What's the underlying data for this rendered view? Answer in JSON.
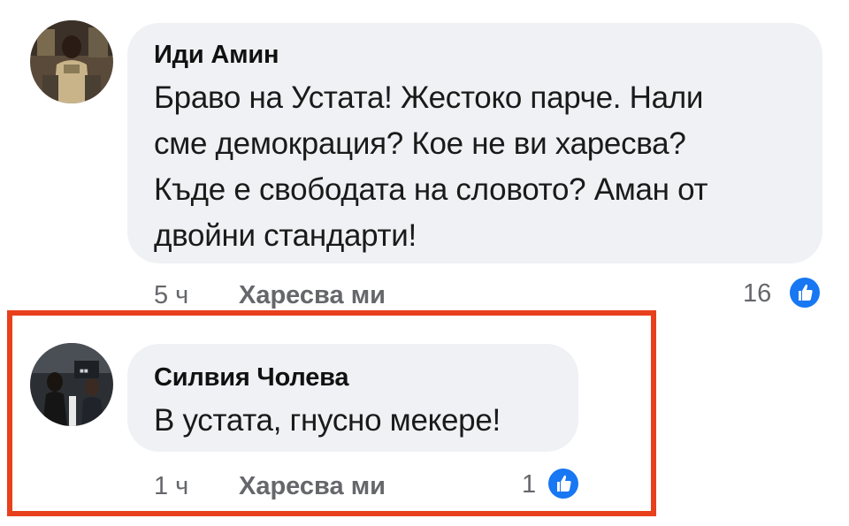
{
  "colors": {
    "bubble_background": "#eff1f4",
    "highlight_border": "#e8401c",
    "like_badge": "#1877f2",
    "meta_text": "#65676b"
  },
  "comments": [
    {
      "author": "Иди Амин",
      "text_lines": [
        "Браво на Устата! Жестоко парче. Нали",
        "сме демокрация? Кое не ви харесва?",
        "Къде е свободата на словото? Аман от",
        "двойни стандарти!"
      ],
      "time": "5 ч",
      "like_label": "Харесва ми",
      "reaction_count": "16",
      "reaction_icon": "thumbs-up-icon",
      "highlighted": false
    },
    {
      "author": "Силвия Чолева",
      "text_lines": [
        "В устата, гнусно мекере!"
      ],
      "time": "1 ч",
      "like_label": "Харесва ми",
      "reaction_count": "1",
      "reaction_icon": "thumbs-up-icon",
      "highlighted": true
    }
  ]
}
